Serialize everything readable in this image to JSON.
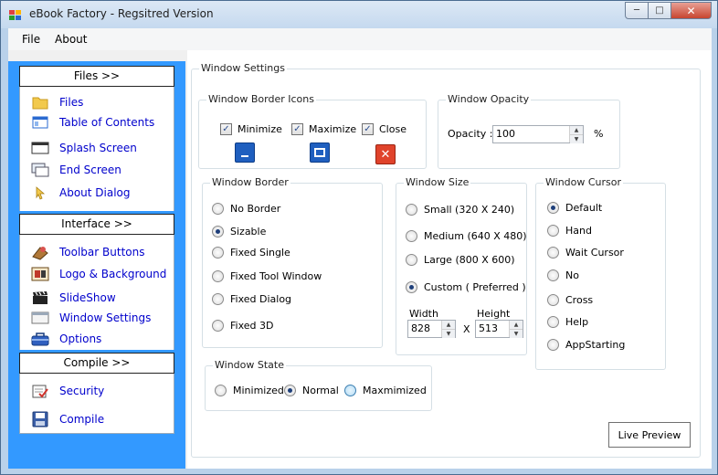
{
  "window": {
    "title": "eBook Factory - Regsitred Version"
  },
  "menu": {
    "file": "File",
    "about": "About"
  },
  "nav": {
    "files_header": "Files >>",
    "files_items": [
      {
        "label": "Files",
        "icon": "folder-icon"
      },
      {
        "label": "Table of Contents",
        "icon": "table-of-contents-icon"
      },
      {
        "label": "Splash Screen",
        "icon": "splash-screen-icon"
      },
      {
        "label": "End Screen",
        "icon": "end-screen-icon"
      },
      {
        "label": "About Dialog",
        "icon": "cursor-icon"
      }
    ],
    "interface_header": "Interface >>",
    "interface_items": [
      {
        "label": "Toolbar Buttons",
        "icon": "toolbar-buttons-icon"
      },
      {
        "label": "Logo & Background",
        "icon": "logo-background-icon"
      },
      {
        "label": "SlideShow",
        "icon": "clapperboard-icon"
      },
      {
        "label": "Window Settings",
        "icon": "window-settings-icon"
      },
      {
        "label": "Options",
        "icon": "toolbox-icon"
      }
    ],
    "compile_header": "Compile >>",
    "compile_items": [
      {
        "label": "Security",
        "icon": "security-icon"
      },
      {
        "label": "Compile",
        "icon": "floppy-disk-icon"
      }
    ]
  },
  "settings": {
    "title": "Window Settings",
    "border_icons": {
      "title": "Window Border Icons",
      "minimize": "Minimize",
      "minimize_checked": true,
      "maximize": "Maximize",
      "maximize_checked": true,
      "close": "Close",
      "close_checked": true
    },
    "opacity": {
      "title": "Window Opacity",
      "label": "Opacity :",
      "value": "100",
      "unit": "%"
    },
    "border": {
      "title": "Window Border",
      "selected": "Sizable",
      "options": [
        "No Border",
        "Sizable",
        "Fixed Single",
        "Fixed Tool Window",
        "Fixed Dialog",
        "Fixed 3D"
      ]
    },
    "size": {
      "title": "Window Size",
      "selected": "Custom ( Preferred )",
      "options": [
        "Small (320 X 240)",
        "Medium (640 X 480)",
        "Large (800 X 600)",
        "Custom ( Preferred )"
      ],
      "width_label": "Width",
      "width_value": "828",
      "height_label": "Height",
      "height_value": "513",
      "x_label": "X"
    },
    "cursor": {
      "title": "Window Cursor",
      "selected": "Default",
      "options": [
        "Default",
        "Hand",
        "Wait Cursor",
        "No",
        "Cross",
        "Help",
        "AppStarting"
      ]
    },
    "state": {
      "title": "Window State",
      "selected": "Normal",
      "options": [
        "Minimized",
        "Normal",
        "Maxmimized"
      ]
    },
    "live_preview": "Live Preview"
  },
  "colors": {
    "nav_blue": "#3399ff",
    "link_blue": "#0000cc",
    "close_red": "#e0432b",
    "icon_blue": "#1f5fbf"
  }
}
